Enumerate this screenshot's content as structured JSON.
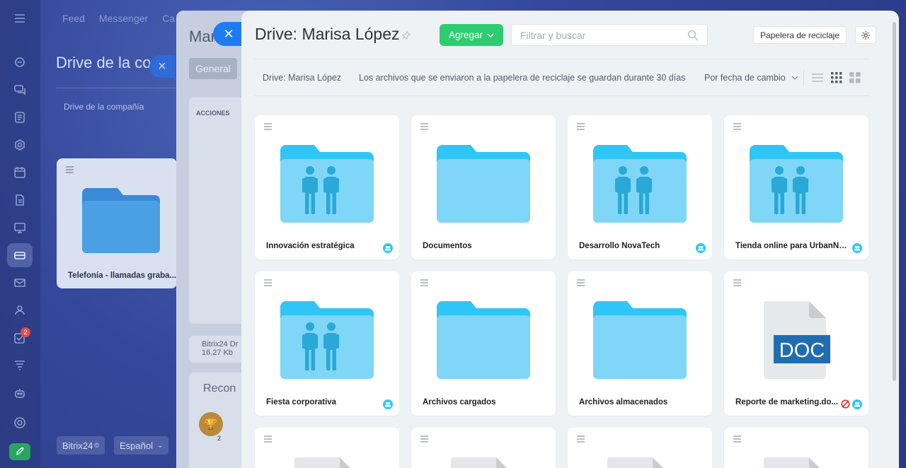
{
  "background": {
    "topnav": [
      "Feed",
      "Messenger",
      "Ca"
    ],
    "title": "Drive de la co",
    "subtitle": "Drive de la compañía",
    "card_label": "Telefonía - llamadas graba...",
    "brand_button": "Bitrix24",
    "language_button": "Español",
    "rail_badge": "2"
  },
  "middle": {
    "title": "Mar",
    "tab": "General",
    "actions": "ACCIONES",
    "file_name": "Bitrix24 Dr",
    "file_size": "16.27 Kb",
    "recognition": "Recon",
    "trophy_count": "2"
  },
  "header": {
    "title": "Drive: Marisa López",
    "add_label": "Agregar",
    "search_placeholder": "Filtrar y buscar",
    "trash_label": "Papelera de reciclaje"
  },
  "toolbar": {
    "breadcrumb": "Drive: Marisa López",
    "notice": "Los archivos que se enviaron a la papelera de reciclaje se guardan durante 30 días",
    "sort_label": "Por fecha de cambio"
  },
  "colors": {
    "accent_green": "#2ecc71",
    "folder_light": "#7fd6f7",
    "folder_tab": "#2fc6f6",
    "people": "#2aa8d8",
    "doc_badge": "#1f6cb0"
  },
  "items": [
    {
      "name": "Innovación estratégica",
      "type": "shared-folder",
      "shared": true,
      "blocked": false
    },
    {
      "name": "Documentos",
      "type": "folder",
      "shared": false,
      "blocked": false
    },
    {
      "name": "Desarrollo NovaTech",
      "type": "shared-folder",
      "shared": true,
      "blocked": false
    },
    {
      "name": "Tienda online para UrbanNe...",
      "type": "shared-folder",
      "shared": true,
      "blocked": false
    },
    {
      "name": "Fiesta corporativa",
      "type": "shared-folder",
      "shared": true,
      "blocked": false
    },
    {
      "name": "Archivos cargados",
      "type": "folder",
      "shared": false,
      "blocked": false
    },
    {
      "name": "Archivos almacenados",
      "type": "folder",
      "shared": false,
      "blocked": false
    },
    {
      "name": "Reporte de marketing.do...",
      "type": "doc",
      "shared": true,
      "blocked": true,
      "badge": "DOC"
    }
  ]
}
